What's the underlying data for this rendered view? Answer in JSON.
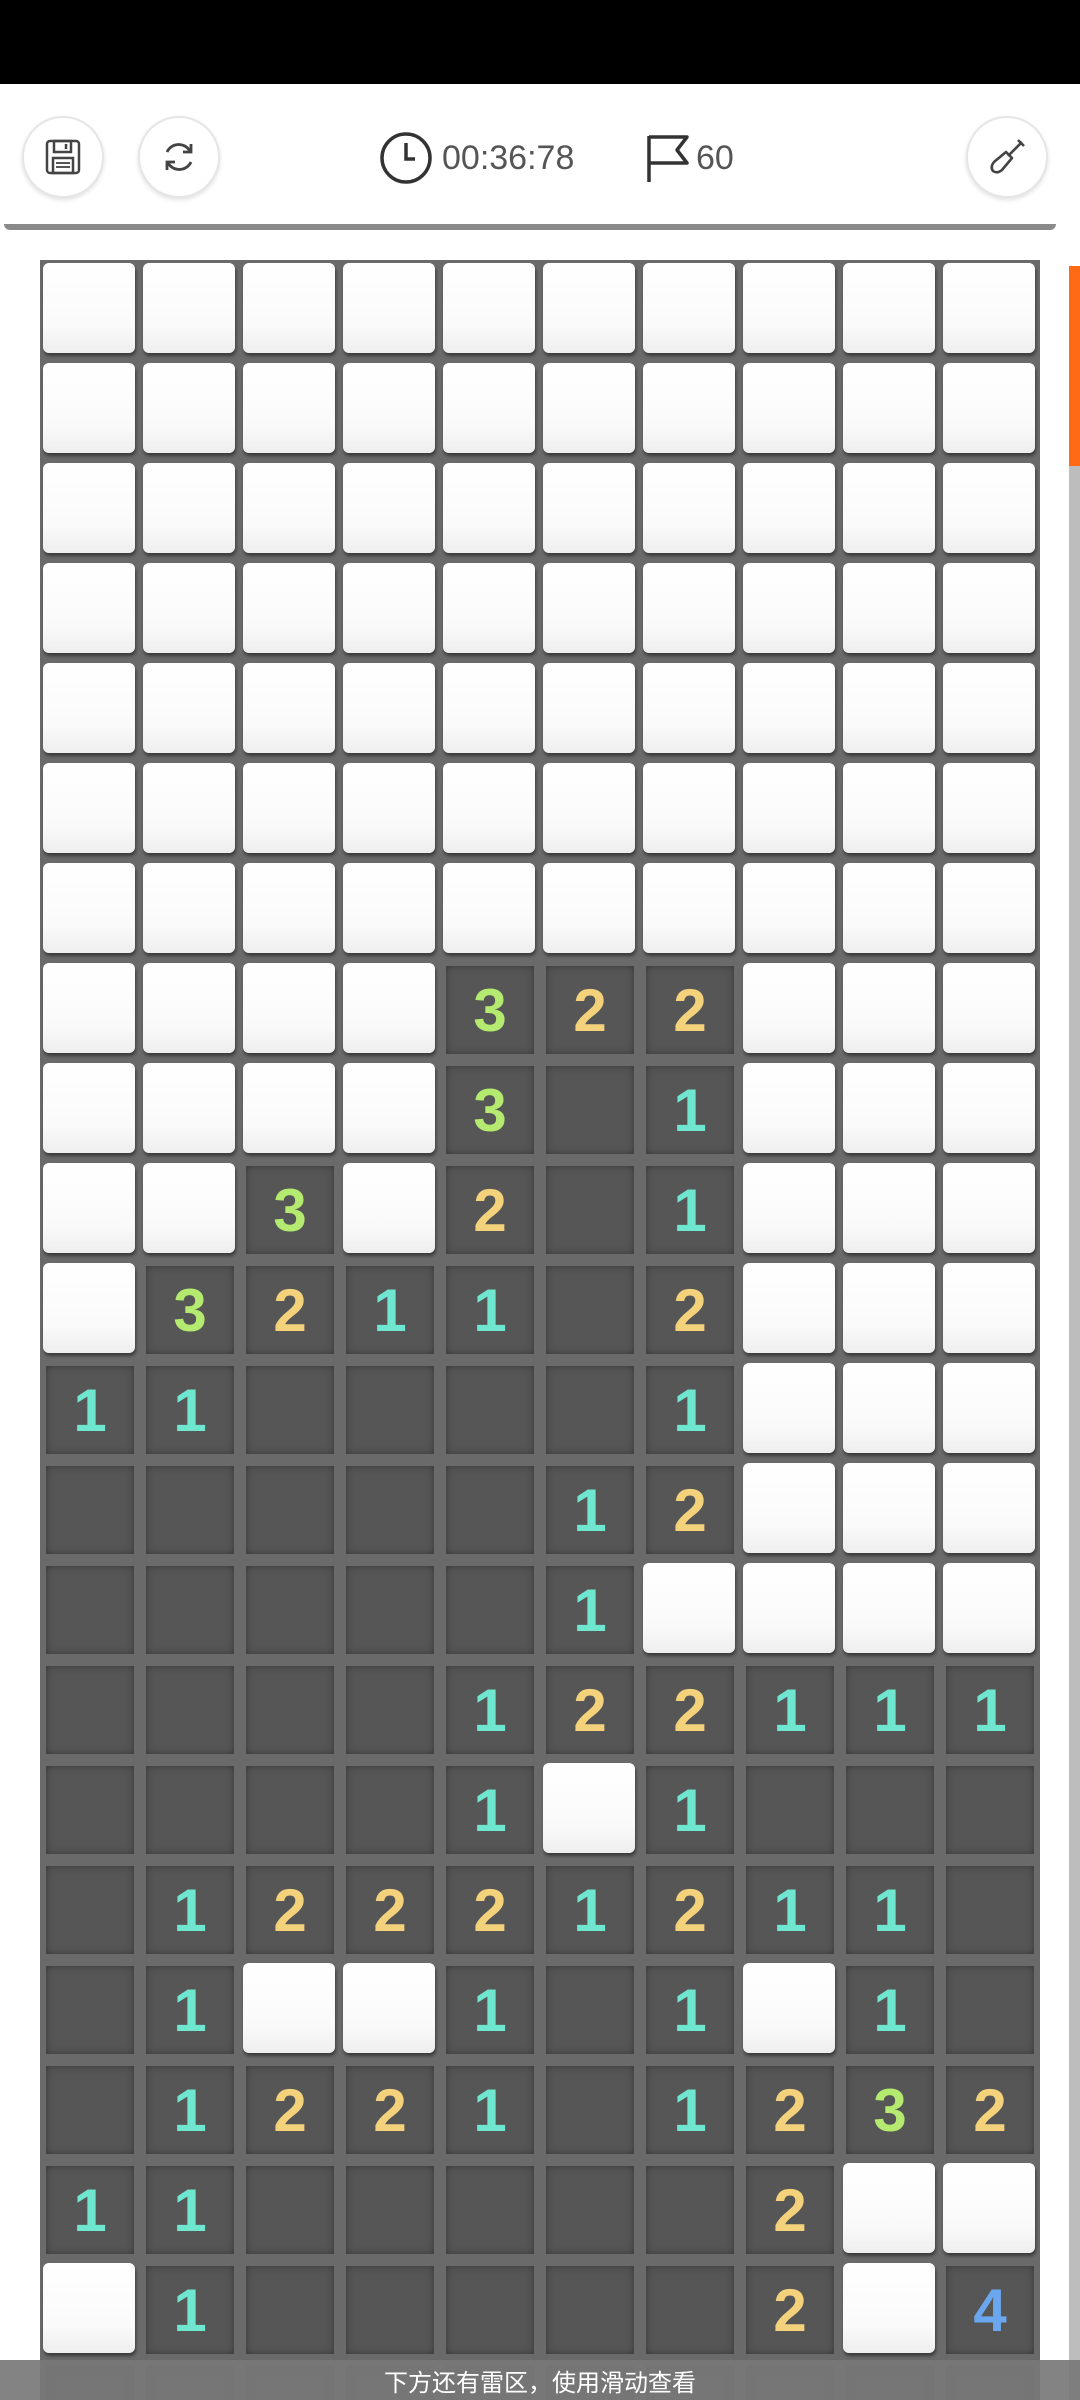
{
  "toolbar": {
    "save_icon": "save-icon",
    "restart_icon": "refresh-icon",
    "timer": "00:36:78",
    "flags": "60",
    "shovel_icon": "shovel-icon"
  },
  "board": {
    "columns": 10,
    "legend": "C = covered cell, 0 = opened empty cell, 1-4 = opened cell showing that number",
    "rows": [
      [
        "C",
        "C",
        "C",
        "C",
        "C",
        "C",
        "C",
        "C",
        "C",
        "C"
      ],
      [
        "C",
        "C",
        "C",
        "C",
        "C",
        "C",
        "C",
        "C",
        "C",
        "C"
      ],
      [
        "C",
        "C",
        "C",
        "C",
        "C",
        "C",
        "C",
        "C",
        "C",
        "C"
      ],
      [
        "C",
        "C",
        "C",
        "C",
        "C",
        "C",
        "C",
        "C",
        "C",
        "C"
      ],
      [
        "C",
        "C",
        "C",
        "C",
        "C",
        "C",
        "C",
        "C",
        "C",
        "C"
      ],
      [
        "C",
        "C",
        "C",
        "C",
        "C",
        "C",
        "C",
        "C",
        "C",
        "C"
      ],
      [
        "C",
        "C",
        "C",
        "C",
        "C",
        "C",
        "C",
        "C",
        "C",
        "C"
      ],
      [
        "C",
        "C",
        "C",
        "C",
        "3",
        "2",
        "2",
        "C",
        "C",
        "C"
      ],
      [
        "C",
        "C",
        "C",
        "C",
        "3",
        "0",
        "1",
        "C",
        "C",
        "C"
      ],
      [
        "C",
        "C",
        "3",
        "C",
        "2",
        "0",
        "1",
        "C",
        "C",
        "C"
      ],
      [
        "C",
        "3",
        "2",
        "1",
        "1",
        "0",
        "2",
        "C",
        "C",
        "C"
      ],
      [
        "1",
        "1",
        "0",
        "0",
        "0",
        "0",
        "1",
        "C",
        "C",
        "C"
      ],
      [
        "0",
        "0",
        "0",
        "0",
        "0",
        "1",
        "2",
        "C",
        "C",
        "C"
      ],
      [
        "0",
        "0",
        "0",
        "0",
        "0",
        "1",
        "C",
        "C",
        "C",
        "C"
      ],
      [
        "0",
        "0",
        "0",
        "0",
        "1",
        "2",
        "2",
        "1",
        "1",
        "1"
      ],
      [
        "0",
        "0",
        "0",
        "0",
        "1",
        "C",
        "1",
        "0",
        "0",
        "0"
      ],
      [
        "0",
        "1",
        "2",
        "2",
        "2",
        "1",
        "2",
        "1",
        "1",
        "0"
      ],
      [
        "0",
        "1",
        "C",
        "C",
        "1",
        "0",
        "1",
        "C",
        "1",
        "0"
      ],
      [
        "0",
        "1",
        "2",
        "2",
        "1",
        "0",
        "1",
        "2",
        "3",
        "2"
      ],
      [
        "1",
        "1",
        "0",
        "0",
        "0",
        "0",
        "0",
        "2",
        "C",
        "C"
      ],
      [
        "C",
        "1",
        "0",
        "0",
        "0",
        "0",
        "0",
        "2",
        "C",
        "4"
      ],
      [
        "0",
        "0",
        "0",
        "0",
        "0",
        "0",
        "0",
        "0",
        "0",
        "0"
      ]
    ]
  },
  "colors": {
    "one": "#6fe6cf",
    "two": "#f4d27c",
    "three": "#b4ea6f",
    "four": "#6ba7ee",
    "scroll_accent": "#ff6a14"
  },
  "hint": "下方还有雷区，使用滑动查看"
}
